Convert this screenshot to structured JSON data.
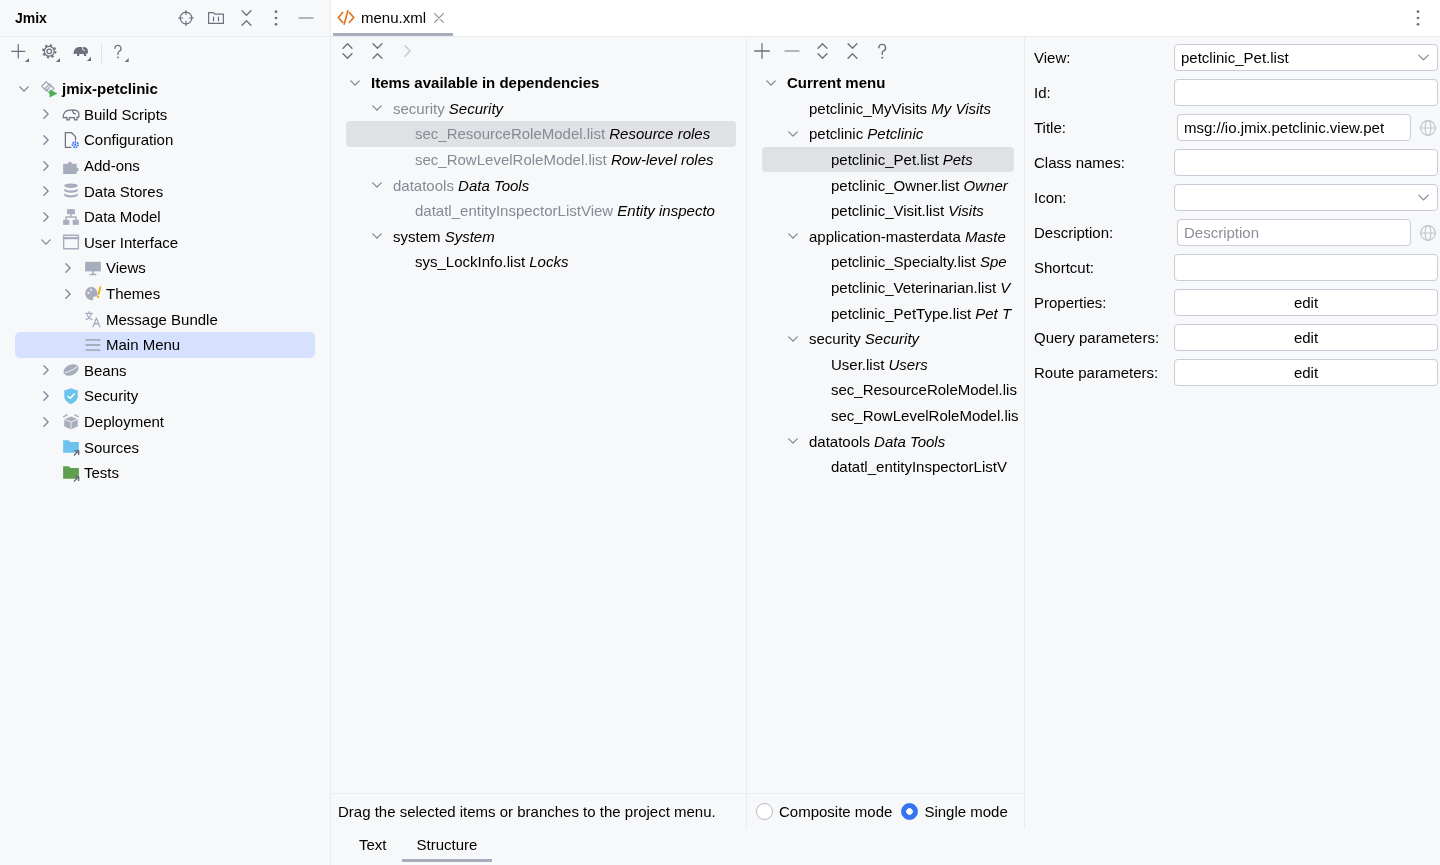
{
  "sidebar": {
    "title": "Jmix",
    "tree": [
      {
        "label": "jmix-petclinic",
        "expanded": true,
        "selected": false,
        "children": [
          {
            "label": "Build Scripts",
            "expanded": false,
            "selected": false
          },
          {
            "label": "Configuration",
            "expanded": false,
            "selected": false
          },
          {
            "label": "Add-ons",
            "expanded": false,
            "selected": false
          },
          {
            "label": "Data Stores",
            "expanded": false,
            "selected": false
          },
          {
            "label": "Data Model",
            "expanded": false,
            "selected": false
          },
          {
            "label": "User Interface",
            "expanded": true,
            "selected": false,
            "children": [
              {
                "label": "Views",
                "expanded": false,
                "selected": false
              },
              {
                "label": "Themes",
                "expanded": false,
                "selected": false
              },
              {
                "label": "Message Bundle",
                "selected": false
              },
              {
                "label": "Main Menu",
                "selected": true
              }
            ]
          },
          {
            "label": "Beans",
            "expanded": false,
            "selected": false
          },
          {
            "label": "Security",
            "expanded": false,
            "selected": false
          },
          {
            "label": "Deployment",
            "expanded": false,
            "selected": false
          },
          {
            "label": "Sources",
            "selected": false
          },
          {
            "label": "Tests",
            "selected": false
          }
        ]
      }
    ]
  },
  "editor_tabs": [
    {
      "label": "menu.xml",
      "selected": true
    }
  ],
  "available_items": {
    "tree": [
      {
        "label": "Items available in dependencies",
        "expanded": true,
        "selected": false,
        "disabled": false,
        "children": [
          {
            "label": "security *Security*",
            "expanded": true,
            "selected": false,
            "disabled": true,
            "children": [
              {
                "label": "sec_ResourceRoleModel.list *Resource roles*",
                "selected": true,
                "disabled": true
              },
              {
                "label": "sec_RowLevelRoleModel.list *Row-level roles*",
                "selected": false,
                "disabled": true
              }
            ]
          },
          {
            "label": "datatools *Data Tools*",
            "expanded": true,
            "selected": false,
            "disabled": true,
            "children": [
              {
                "label": "datatl_entityInspectorListView *Entity inspecto*",
                "selected": false,
                "disabled": true
              }
            ]
          },
          {
            "label": "system *System*",
            "expanded": true,
            "selected": false,
            "disabled": false,
            "children": [
              {
                "label": "sys_LockInfo.list *Locks*",
                "selected": false,
                "disabled": false
              }
            ]
          }
        ]
      }
    ],
    "hint": "Drag the selected items or branches to the project menu."
  },
  "current_menu": {
    "tree": [
      {
        "label": "Current menu",
        "expanded": true,
        "selected": false,
        "children": [
          {
            "label": "petclinic_MyVisits *My Visits*",
            "selected": false
          },
          {
            "label": "petclinic *Petclinic*",
            "expanded": true,
            "selected": false,
            "children": [
              {
                "label": "petclinic_Pet.list *Pets*",
                "selected": true
              },
              {
                "label": "petclinic_Owner.list *Owner*",
                "selected": false
              },
              {
                "label": "petclinic_Visit.list *Visits*",
                "selected": false
              }
            ]
          },
          {
            "label": "application-masterdata *Maste*",
            "expanded": true,
            "selected": false,
            "children": [
              {
                "label": "petclinic_Specialty.list *Spe*",
                "selected": false
              },
              {
                "label": "petclinic_Veterinarian.list *V*",
                "selected": false
              },
              {
                "label": "petclinic_PetType.list *Pet T*",
                "selected": false
              }
            ]
          },
          {
            "label": "security *Security*",
            "expanded": true,
            "selected": false,
            "children": [
              {
                "label": "User.list *Users*",
                "selected": false
              },
              {
                "label": "sec_ResourceRoleModel.lis",
                "selected": false
              },
              {
                "label": "sec_RowLevelRoleModel.lis",
                "selected": false
              }
            ]
          },
          {
            "label": "datatools *Data Tools*",
            "expanded": true,
            "selected": false,
            "children": [
              {
                "label": "datatl_entityInspectorListV",
                "selected": false
              }
            ]
          }
        ]
      }
    ],
    "modes": [
      {
        "label": "Composite mode",
        "selected": false
      },
      {
        "label": "Single mode",
        "selected": true
      }
    ]
  },
  "properties": {
    "fields": [
      {
        "label": "View:",
        "kind": "dropdown",
        "value": "petclinic_Pet.list"
      },
      {
        "label": "Id:",
        "kind": "text"
      },
      {
        "label": "Title:",
        "kind": "localized",
        "value": "msg://io.jmix.petclinic.view.pet"
      },
      {
        "label": "Class names:",
        "kind": "text"
      },
      {
        "label": "Icon:",
        "kind": "dropdown"
      },
      {
        "label": "Description:",
        "kind": "localized",
        "placeholder": "Description"
      },
      {
        "label": "Shortcut:",
        "kind": "text"
      },
      {
        "label": "Properties:",
        "kind": "button",
        "button": "edit"
      },
      {
        "label": "Query parameters:",
        "kind": "button",
        "button": "edit"
      },
      {
        "label": "Route parameters:",
        "kind": "button",
        "button": "edit"
      }
    ]
  },
  "bottom_tabs": [
    {
      "label": "Text",
      "selected": false
    },
    {
      "label": "Structure",
      "selected": true
    }
  ]
}
